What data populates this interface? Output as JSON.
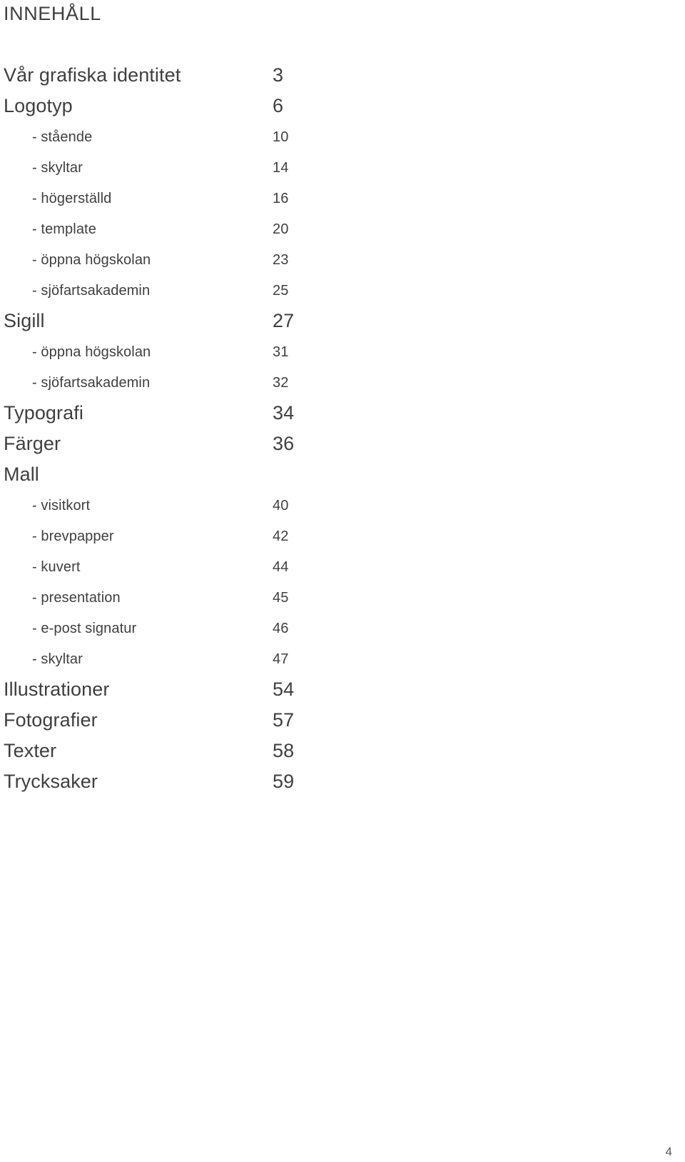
{
  "heading": "INNEHÅLL",
  "folio": "4",
  "colors": {
    "text": "#3f3f3f",
    "background": "#ffffff"
  },
  "entries": [
    {
      "level": "main",
      "label": "Vår grafiska identitet",
      "page": "3"
    },
    {
      "level": "main",
      "label": "Logotyp",
      "page": "6"
    },
    {
      "level": "sub",
      "label": "- stående",
      "page": "10"
    },
    {
      "level": "sub",
      "label": "- skyltar",
      "page": "14"
    },
    {
      "level": "sub",
      "label": "- högerställd",
      "page": "16"
    },
    {
      "level": "sub",
      "label": "- template",
      "page": "20"
    },
    {
      "level": "sub",
      "label": "- öppna högskolan",
      "page": "23"
    },
    {
      "level": "sub",
      "label": "- sjöfartsakademin",
      "page": "25"
    },
    {
      "level": "main",
      "label": "Sigill",
      "page": "27"
    },
    {
      "level": "sub",
      "label": "- öppna högskolan",
      "page": "31"
    },
    {
      "level": "sub",
      "label": "- sjöfartsakademin",
      "page": "32"
    },
    {
      "level": "main",
      "label": "Typografi",
      "page": "34"
    },
    {
      "level": "main",
      "label": "Färger",
      "page": "36"
    },
    {
      "level": "main",
      "label": "Mall",
      "page": ""
    },
    {
      "level": "sub",
      "label": "- visitkort",
      "page": "40"
    },
    {
      "level": "sub",
      "label": "- brevpapper",
      "page": "42"
    },
    {
      "level": "sub",
      "label": "- kuvert",
      "page": "44"
    },
    {
      "level": "sub",
      "label": "- presentation",
      "page": "45"
    },
    {
      "level": "sub",
      "label": "- e-post signatur",
      "page": "46"
    },
    {
      "level": "sub",
      "label": "- skyltar",
      "page": "47"
    },
    {
      "level": "main",
      "label": "Illustrationer",
      "page": "54"
    },
    {
      "level": "main",
      "label": "Fotografier",
      "page": "57"
    },
    {
      "level": "main",
      "label": "Texter",
      "page": "58"
    },
    {
      "level": "main",
      "label": "Trycksaker",
      "page": "59"
    }
  ]
}
